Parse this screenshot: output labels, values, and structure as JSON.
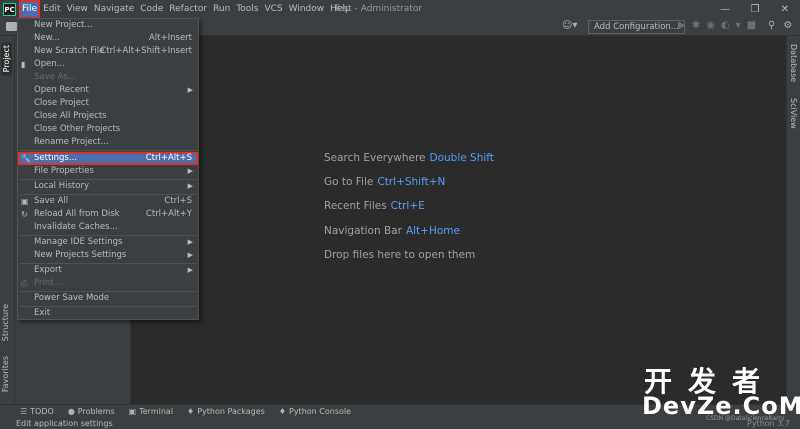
{
  "window": {
    "title": "Test - Administrator",
    "controls": [
      "—",
      "❐",
      "✕"
    ]
  },
  "menubar": [
    "File",
    "Edit",
    "View",
    "Navigate",
    "Code",
    "Refactor",
    "Run",
    "Tools",
    "VCS",
    "Window",
    "Help"
  ],
  "toolbar": {
    "add_configuration": "Add Configuration..."
  },
  "left_stripe": {
    "project": "Project",
    "structure": "Structure",
    "favorites": "Favorites"
  },
  "right_stripe": {
    "database": "Database",
    "sciview": "SciView"
  },
  "editor_hints": [
    {
      "label": "Search Everywhere",
      "key": "Double Shift"
    },
    {
      "label": "Go to File",
      "key": "Ctrl+Shift+N"
    },
    {
      "label": "Recent Files",
      "key": "Ctrl+E"
    },
    {
      "label": "Navigation Bar",
      "key": "Alt+Home"
    },
    {
      "label": "Drop files here to open them",
      "key": ""
    }
  ],
  "file_menu": {
    "new_project": "New Project...",
    "new": "New...",
    "new_sc": "Alt+Insert",
    "new_scratch": "New Scratch File",
    "new_scratch_sc": "Ctrl+Alt+Shift+Insert",
    "open": "Open...",
    "save_as": "Save As...",
    "open_recent": "Open Recent",
    "close_project": "Close Project",
    "close_all": "Close All Projects",
    "close_other": "Close Other Projects",
    "rename_project": "Rename Project...",
    "settings": "Settings...",
    "settings_sc": "Ctrl+Alt+S",
    "file_properties": "File Properties",
    "local_history": "Local History",
    "save_all": "Save All",
    "save_all_sc": "Ctrl+S",
    "reload": "Reload All from Disk",
    "reload_sc": "Ctrl+Alt+Y",
    "invalidate": "Invalidate Caches...",
    "manage_ide": "Manage IDE Settings",
    "new_projects_settings": "New Projects Settings",
    "export": "Export",
    "print": "Print...",
    "power_save": "Power Save Mode",
    "exit": "Exit"
  },
  "bottom_bar": [
    "TODO",
    "Problems",
    "Terminal",
    "Python Packages",
    "Python Console"
  ],
  "status": {
    "text": "Edit application settings",
    "right": "Python 3.7"
  },
  "watermark": {
    "cn": "开发者",
    "en": "DevZe.CoM",
    "small": "CSDN @DataScienceKarry"
  },
  "colors": {
    "accent": "#4b6eaf",
    "highlight_border": "#d8342f",
    "key_blue": "#589df6"
  }
}
